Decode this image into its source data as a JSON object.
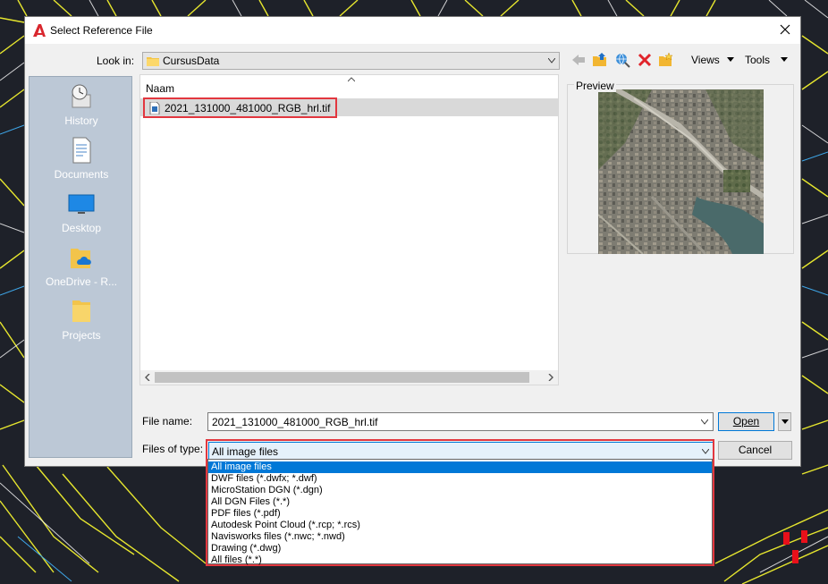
{
  "window": {
    "title": "Select Reference File"
  },
  "look_in": {
    "label": "Look in:",
    "value": "CursusData"
  },
  "toolbar": {
    "views_label": "Views",
    "tools_label": "Tools"
  },
  "places": [
    {
      "label": "History",
      "icon": "history-icon"
    },
    {
      "label": "Documents",
      "icon": "documents-icon"
    },
    {
      "label": "Desktop",
      "icon": "desktop-icon"
    },
    {
      "label": "OneDrive - R...",
      "icon": "onedrive-icon"
    },
    {
      "label": "Projects",
      "icon": "projects-folder-icon"
    }
  ],
  "file_list": {
    "column_header": "Naam",
    "files": [
      {
        "name": "2021_131000_481000_RGB_hrl.tif",
        "selected": true
      }
    ]
  },
  "preview": {
    "label": "Preview"
  },
  "file_name": {
    "label": "File name:",
    "value": "2021_131000_481000_RGB_hrl.tif"
  },
  "files_of_type": {
    "label": "Files of type:",
    "value": "All image files",
    "options": [
      "All image files",
      "DWF files (*.dwfx; *.dwf)",
      "MicroStation DGN (*.dgn)",
      "All DGN Files (*.*)",
      "PDF files (*.pdf)",
      "Autodesk Point Cloud (*.rcp; *.rcs)",
      "Navisworks files (*.nwc; *.nwd)",
      "Drawing (*.dwg)",
      "All files (*.*)"
    ]
  },
  "buttons": {
    "open": "Open",
    "cancel": "Cancel"
  },
  "colors": {
    "highlight_red": "#e2373f",
    "selection_blue": "#0078d7",
    "cad_background": "#1e2129"
  }
}
